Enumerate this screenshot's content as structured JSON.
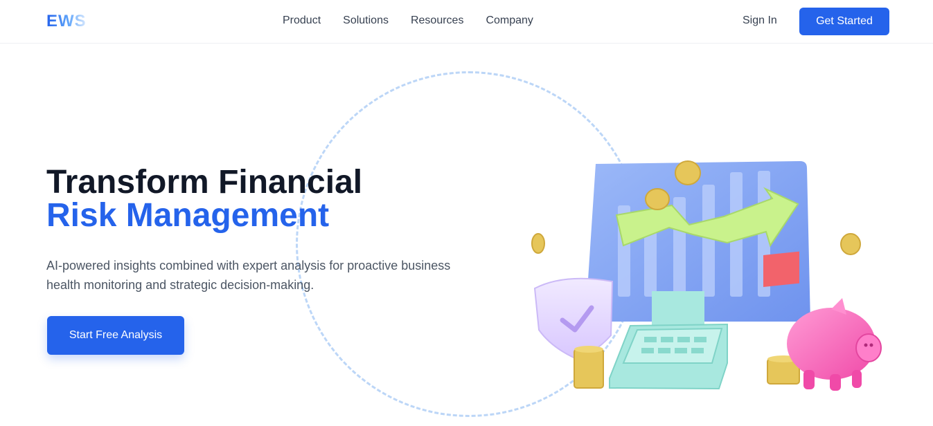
{
  "brand": {
    "logo_text": "EWS"
  },
  "nav": {
    "items": [
      "Product",
      "Solutions",
      "Resources",
      "Company"
    ],
    "sign_in": "Sign In",
    "get_started": "Get Started"
  },
  "hero": {
    "title_line1": "Transform Financial",
    "title_line2": "Risk Management",
    "subtitle": "AI-powered insights combined with expert analysis for proactive business health monitoring and strategic decision-making.",
    "cta": "Start Free Analysis"
  },
  "illustration": {
    "icons": [
      "bar-chart-board-icon",
      "trend-arrow-icon",
      "shield-check-icon",
      "calculator-icon",
      "piggy-bank-icon",
      "coin-stack-icon",
      "coin-icon"
    ]
  },
  "colors": {
    "accent": "#2563eb",
    "heading": "#111827",
    "body_text": "#4b5563",
    "ring": "#bcd6f7",
    "board": "#8fb0f5",
    "arrow": "#c9f28c",
    "piggy": "#ff6fc2",
    "calculator": "#a8e8df",
    "coin": "#e6c65a"
  }
}
